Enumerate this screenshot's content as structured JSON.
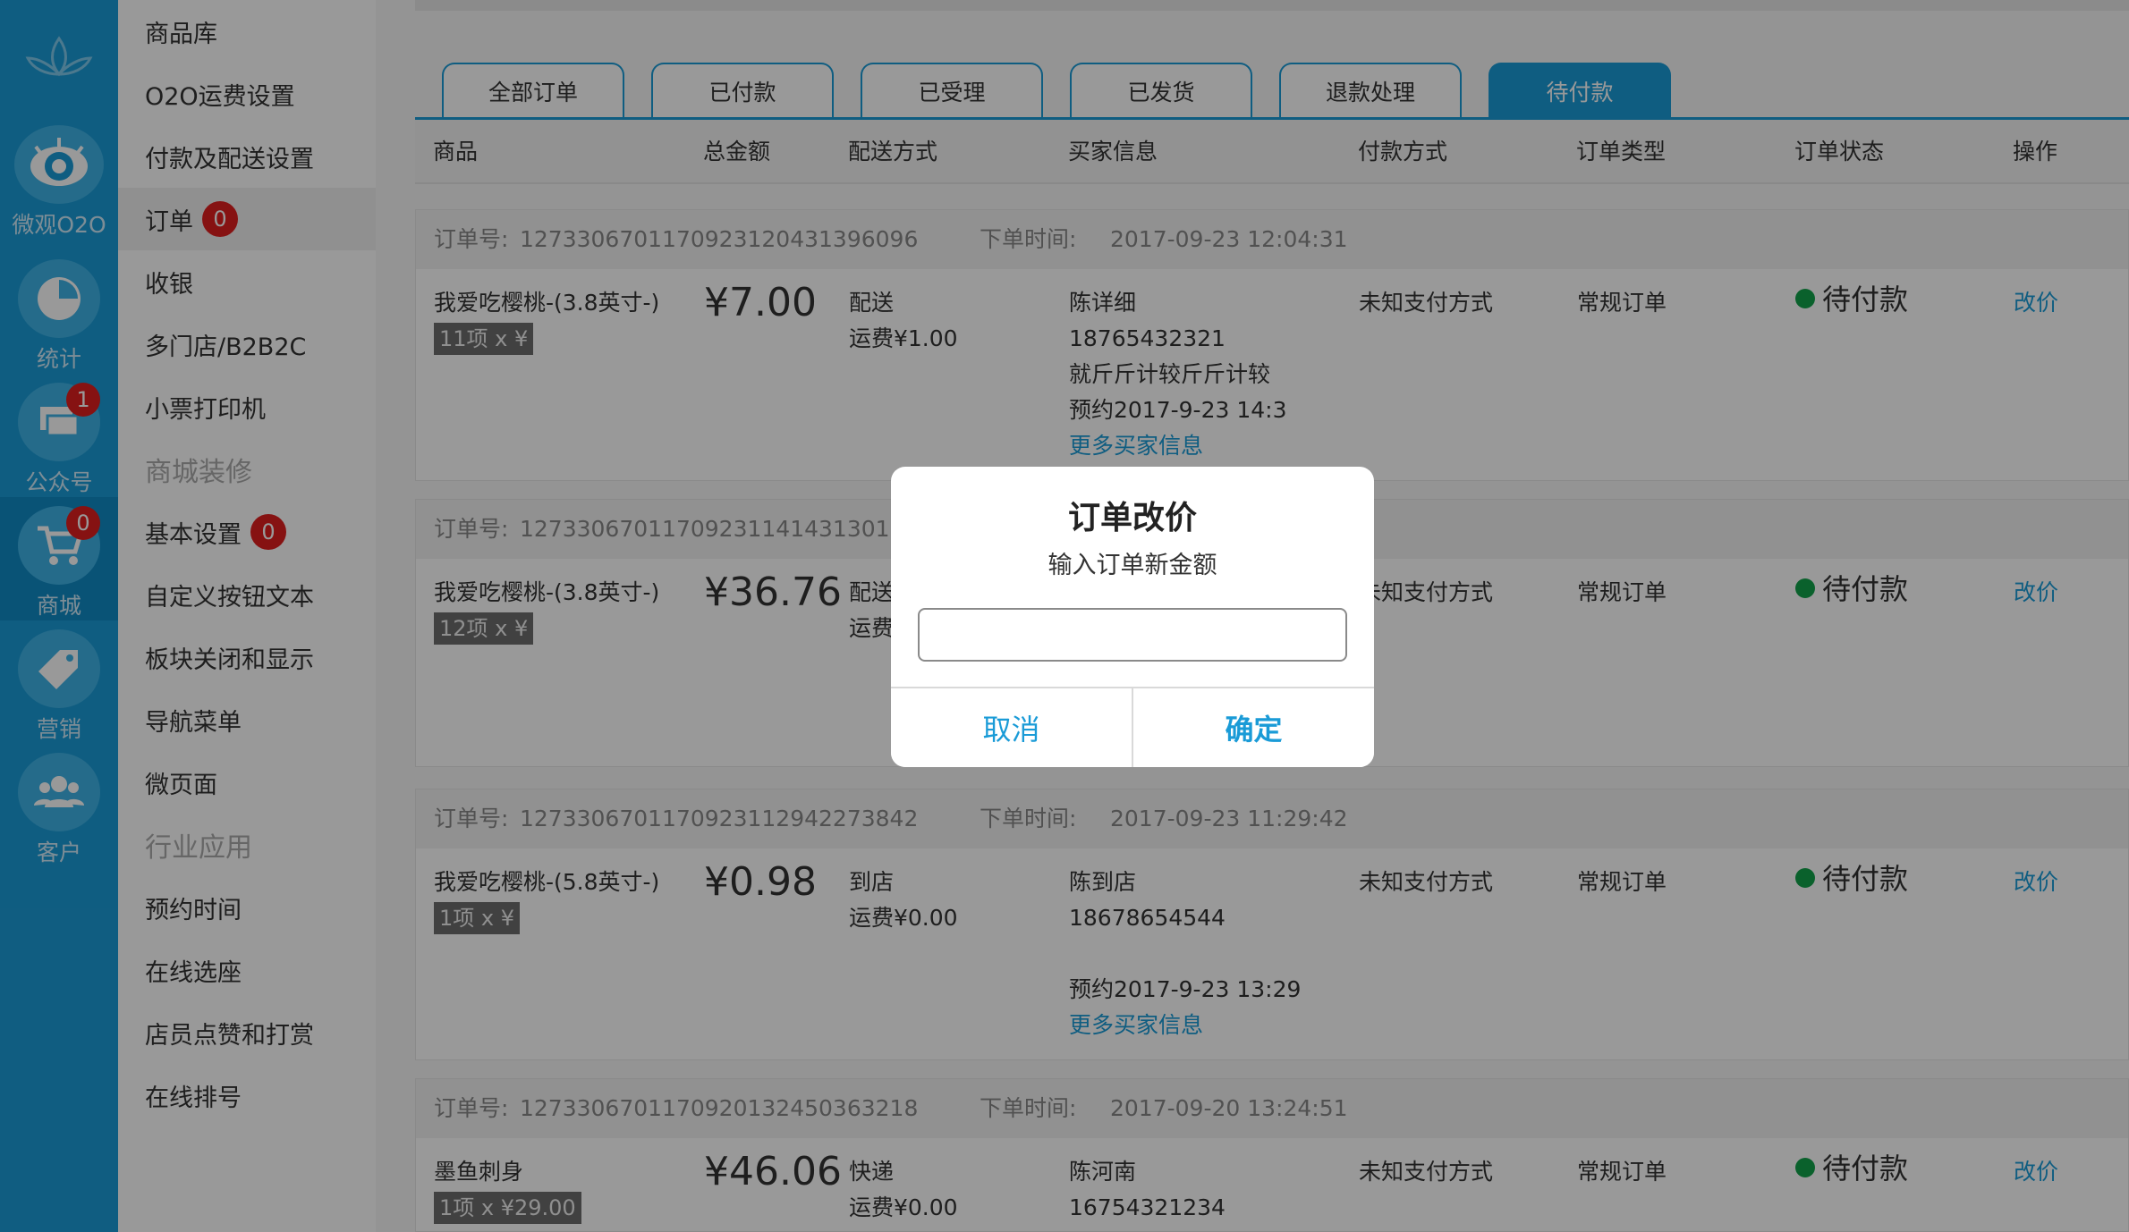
{
  "rail": [
    {
      "label": "微观O2O",
      "icon": "eye-icon"
    },
    {
      "label": "统计",
      "icon": "pie-chart-icon"
    },
    {
      "label": "公众号",
      "icon": "chat-icon",
      "badge": "1"
    },
    {
      "label": "商城",
      "icon": "cart-icon",
      "badge": "0"
    },
    {
      "label": "营销",
      "icon": "tag-icon"
    },
    {
      "label": "客户",
      "icon": "users-icon"
    }
  ],
  "menu": [
    {
      "label": "商品库"
    },
    {
      "label": "O2O运费设置"
    },
    {
      "label": "付款及配送设置"
    },
    {
      "label": "订单",
      "badge": "0"
    },
    {
      "label": "收银"
    },
    {
      "label": "多门店/B2B2C"
    },
    {
      "label": "小票打印机"
    },
    {
      "label": "商城装修"
    },
    {
      "label": "基本设置",
      "badge": "0"
    },
    {
      "label": "自定义按钮文本"
    },
    {
      "label": "板块关闭和显示"
    },
    {
      "label": "导航菜单"
    },
    {
      "label": "微页面"
    },
    {
      "label": "行业应用"
    },
    {
      "label": "预约时间"
    },
    {
      "label": "在线选座"
    },
    {
      "label": "店员点赞和打赏"
    },
    {
      "label": "在线排号"
    }
  ],
  "tabs": [
    "全部订单",
    "已付款",
    "已受理",
    "已发货",
    "退款处理",
    "待付款"
  ],
  "columns": [
    "商品",
    "总金额",
    "配送方式",
    "买家信息",
    "付款方式",
    "订单类型",
    "订单状态",
    "操作"
  ],
  "labels": {
    "order_no": "订单号:",
    "order_time": "下单时间:",
    "more_buyer": "更多买家信息",
    "edit_price": "改价"
  },
  "orders": [
    {
      "no": "12733067011709231204313960​96",
      "time": "2017-09-23 12:04:31",
      "goods": "我爱吃樱桃-(3.8英寸-)",
      "qty": "11项 x ¥",
      "price": "¥7.00",
      "ship": "配送",
      "fee": "运费¥1.00",
      "buyer": "陈详细",
      "phone": "18765432321",
      "address": "就斤斤计较斤斤计较",
      "appt": "预约2017-9-23 14:3",
      "pay": "未知支付方式",
      "type": "常规订单",
      "status": "待付款"
    },
    {
      "no": "12733067011709231141431301​92",
      "goods": "我爱吃樱桃-(3.8英寸-)",
      "qty": "12项 x ¥",
      "price": "¥36.76",
      "ship": "配送",
      "fee": "运费",
      "pay": "未知支付方式",
      "type": "常规订单",
      "status": "待付款"
    },
    {
      "no": "12733067011709231129422738​42",
      "time": "2017-09-23 11:29:42",
      "goods": "我爱吃樱桃-(5.8英寸-)",
      "qty": "1项 x ¥",
      "price": "¥0.98",
      "ship": "到店",
      "fee": "运费¥0.00",
      "buyer": "陈到店",
      "phone": "18678654544",
      "appt": "预约2017-9-23 13:29",
      "pay": "未知支付方式",
      "type": "常规订单",
      "status": "待付款"
    },
    {
      "no": "12733067011709201324503632​18",
      "time": "2017-09-20 13:24:51",
      "goods": "墨鱼刺身",
      "qty": "1项 x ¥29.00",
      "price": "¥46.06",
      "ship": "快递",
      "fee": "运费¥0.00",
      "buyer": "陈河南",
      "phone": "16754321234",
      "pay": "未知支付方式",
      "type": "常规订单",
      "status": "待付款"
    }
  ],
  "dialog": {
    "title": "订单改价",
    "subtitle": "输入订单新金额",
    "input_value": "",
    "cancel": "取消",
    "confirm": "确定"
  },
  "colors": {
    "accent": "#1a9bd7",
    "badge": "#e01f1f",
    "status_dot": "#11a24a"
  }
}
